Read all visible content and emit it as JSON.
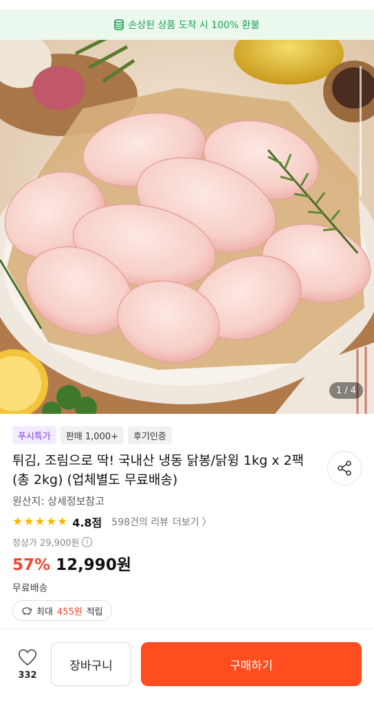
{
  "banner": {
    "text": "손상된 상품 도착 시 100% 환불",
    "icon": "coin-stack-icon",
    "color": "#1f9d55"
  },
  "gallery": {
    "counter": "1 / 4",
    "current": 1,
    "total": 4
  },
  "badges": [
    {
      "label": "푸시특가"
    },
    {
      "label": "판매 1,000+"
    },
    {
      "label": "후기인증"
    }
  ],
  "product": {
    "title": "튀김, 조림으로 딱! 국내산 냉동 닭봉/닭윙 1kg x 2팩 (총 2kg) (업체별도 무료배송)",
    "origin": "원산지: 상세정보참고"
  },
  "rating": {
    "stars": 5,
    "score": "4.8점",
    "review_count": "598건의 리뷰",
    "more": "더보기"
  },
  "pricing": {
    "regular": "정상가 29,900원",
    "discount": "57%",
    "price": "12,990원",
    "accent": "#f0452d"
  },
  "shipping": "무료배송",
  "points": {
    "prefix": "최대",
    "amount": "455원",
    "suffix": "적립",
    "icon": "piggy-bank-icon"
  },
  "bottom": {
    "like_count": "332",
    "cart_label": "장바구니",
    "buy_label": "구매하기",
    "buy_color": "#ff4d1f"
  }
}
